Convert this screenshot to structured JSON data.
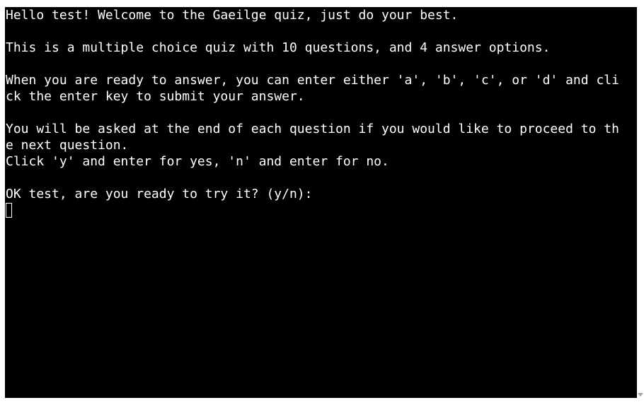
{
  "terminal": {
    "lines": [
      "Hello test! Welcome to the Gaeilge quiz, just do your best.",
      "",
      "This is a multiple choice quiz with 10 questions, and 4 answer options.",
      "",
      "When you are ready to answer, you can enter either 'a', 'b', 'c', or 'd' and cli",
      "ck the enter key to submit your answer.",
      "",
      "You will be asked at the end of each question if you would like to proceed to th",
      "e next question.",
      "Click 'y' and enter for yes, 'n' and enter for no.",
      "",
      "OK test, are you ready to try it? (y/n):"
    ],
    "input_value": ""
  },
  "icons": {
    "scroll_down": "scroll-down-arrow-icon"
  },
  "colors": {
    "background": "#000000",
    "text": "#ffffff",
    "page": "#ffffff"
  }
}
